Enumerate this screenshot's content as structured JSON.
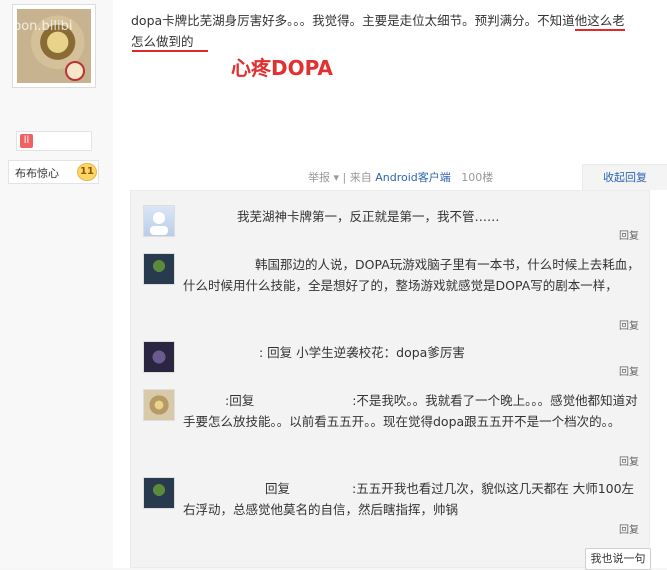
{
  "sidebar": {
    "avatar_watermark": "opon.bilibi",
    "level_label": "ll",
    "fan_name": "布布惊心",
    "fan_level": "11"
  },
  "post": {
    "text_before": "dopa卡牌比芜湖身厉害好多。。。我觉得。主要是走位太细节。预判满分。不知道",
    "text_underline": "他这么老",
    "text_line2": "怎么做到的",
    "annotation": "心疼DOPA",
    "meta_report": "举报",
    "meta_from": "| 来自",
    "meta_client": "Android客户端",
    "meta_floor": "100楼",
    "collapse_label": "收起回复"
  },
  "replies": [
    {
      "text": "我芜湖神卡牌第一，反正就是第一，我不管……",
      "reply_label": "回复"
    },
    {
      "text": "韩国那边的人说，DOPA玩游戏脑子里有一本书，什么时候上去耗血，什么时候用什么技能，全是想好了的，整场游戏就感觉是DOPA写的剧本一样，",
      "reply_label": "回复"
    },
    {
      "text": ": 回复 小学生逆袭校花：dopa爹厉害",
      "reply_label": "回复"
    },
    {
      "text_a": ":回复",
      "text_b": ":不是我吹。。我就看了一个晚上。。。感觉他都知道对手要怎么放技能。。以前看五五开。。现在觉得dopa跟五五开不是一个档次的。。",
      "reply_label": "回复"
    },
    {
      "text_a": "回复",
      "text_b": ":五五开我也看过几次，貌似这几天都在 大师100左右浮动，总感觉他莫名的自信，然后瞎指挥，帅锅",
      "reply_label": "回复"
    }
  ],
  "say_button": "我也说一句",
  "colors": {
    "accent_red": "#e0292b",
    "link_blue": "#2d64b3"
  }
}
